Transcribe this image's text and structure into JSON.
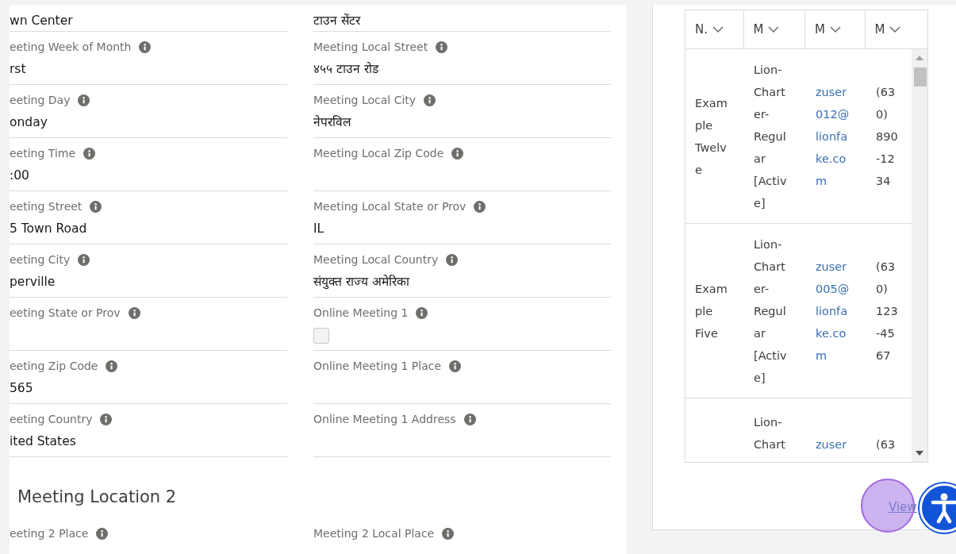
{
  "details": {
    "left": [
      {
        "kind": "text",
        "value": "wn Center"
      },
      {
        "kind": "text",
        "label": "eeting Week of Month",
        "value": "rst"
      },
      {
        "kind": "text",
        "label": "eeting Day",
        "value": "onday"
      },
      {
        "kind": "text",
        "label": "eeting Time",
        "value": ":00"
      },
      {
        "kind": "text",
        "label": "eeting Street",
        "value": "5 Town Road"
      },
      {
        "kind": "text",
        "label": "eeting City",
        "value": "perville"
      },
      {
        "kind": "text",
        "label": "eeting State or Prov"
      },
      {
        "kind": "text",
        "label": "eeting Zip Code",
        "value": "565"
      },
      {
        "kind": "text",
        "label": "eeting Country",
        "value": "ited States"
      }
    ],
    "right": [
      {
        "kind": "text",
        "value": "टाउन सेंटर"
      },
      {
        "kind": "text",
        "label": "Meeting Local Street",
        "value": "४५५ टाउन रोड"
      },
      {
        "kind": "text",
        "label": "Meeting Local City",
        "value": "नेपरविल"
      },
      {
        "kind": "text",
        "label": "Meeting Local Zip Code"
      },
      {
        "kind": "text",
        "label": "Meeting Local State or Prov",
        "value": "IL"
      },
      {
        "kind": "text",
        "label": "Meeting Local Country",
        "value": "संयुक्त राज्य अमेरिका"
      },
      {
        "kind": "checkbox",
        "label": "Online Meeting 1",
        "checked": false
      },
      {
        "kind": "text",
        "label": "Online Meeting 1 Place"
      },
      {
        "kind": "text",
        "label": "Online Meeting 1 Address"
      }
    ]
  },
  "section": {
    "heading": "Meeting Location 2",
    "fields": [
      {
        "label": "eeting 2 Place"
      },
      {
        "label": "Meeting 2 Local Place"
      }
    ]
  },
  "related_table": {
    "columns": [
      "N.",
      "M",
      "M",
      "M"
    ],
    "rows": [
      {
        "cells": [
          {
            "kind": "text",
            "text": "Exam\nple\nTwelv\ne"
          },
          {
            "kind": "text",
            "text": "Lion-\nChart\ner-\nRegul\nar\n[Activ\ne]"
          },
          {
            "kind": "link",
            "text": "zuser\n012@\nlionfa\nke.co\nm"
          },
          {
            "kind": "text",
            "text": "(63\n0)\n890\n-12\n34"
          }
        ]
      },
      {
        "cells": [
          {
            "kind": "text",
            "text": "Exam\nple\nFive"
          },
          {
            "kind": "text",
            "text": "Lion-\nChart\ner-\nRegul\nar\n[Activ\ne]"
          },
          {
            "kind": "link",
            "text": "zuser\n005@\nlionfa\nke.co\nm"
          },
          {
            "kind": "text",
            "text": "(63\n0)\n123\n-45\n67"
          }
        ]
      },
      {
        "cells": [
          {
            "text": ""
          },
          {
            "kind": "text",
            "text": "Lion-\nChart"
          },
          {
            "kind": "link",
            "text": "zuser"
          },
          {
            "kind": "text",
            "text": "(63"
          }
        ]
      }
    ]
  },
  "view_link": "View"
}
